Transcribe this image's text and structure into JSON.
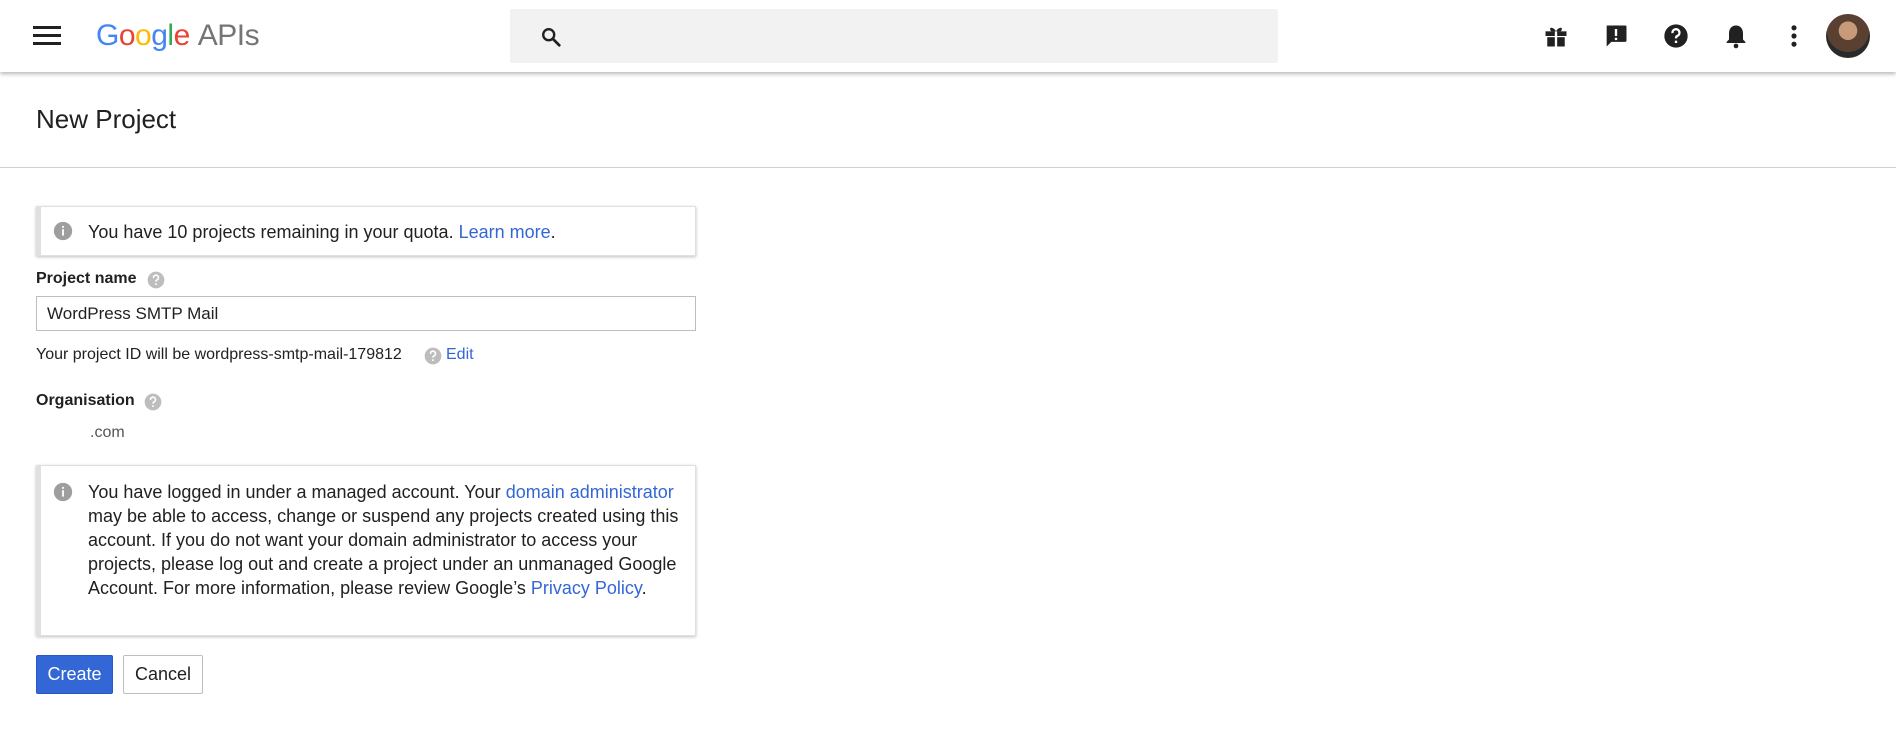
{
  "header": {
    "logo_google_letters": [
      "G",
      "o",
      "o",
      "g",
      "l",
      "e"
    ],
    "logo_product": "APIs",
    "search": {
      "placeholder": "",
      "value": ""
    },
    "icons": [
      "menu-icon",
      "search-icon",
      "gift-icon",
      "feedback-icon",
      "help-icon",
      "notifications-icon",
      "more-vert-icon",
      "avatar"
    ]
  },
  "page": {
    "title": "New Project"
  },
  "quota_notice": {
    "text": "You have 10 projects remaining in your quota.",
    "link_text": "Learn more",
    "suffix": "."
  },
  "form": {
    "project_name_label": "Project name",
    "project_name_value": "WordPress SMTP Mail",
    "project_id_text": "Your project ID will be wordpress-smtp-mail-179812",
    "edit_label": "Edit",
    "organisation_label": "Organisation",
    "organisation_value": ".com"
  },
  "managed_notice": {
    "text_1": "You have logged in under a managed account. Your ",
    "link_1": "domain administrator",
    "text_2": " may be able to access, change or suspend any projects created using this account. If you do not want your domain administrator to access your projects, please log out and create a project under an unmanaged Google Account. For more information, please review Google’s ",
    "link_2": "Privacy Policy",
    "text_3": "."
  },
  "buttons": {
    "create": "Create",
    "cancel": "Cancel"
  },
  "colors": {
    "primary_blue": "#3367d6",
    "link_blue": "#3367d6",
    "google_blue": "#4285F4",
    "google_red": "#EA4335",
    "google_yellow": "#FBBC05",
    "google_green": "#34A853"
  }
}
